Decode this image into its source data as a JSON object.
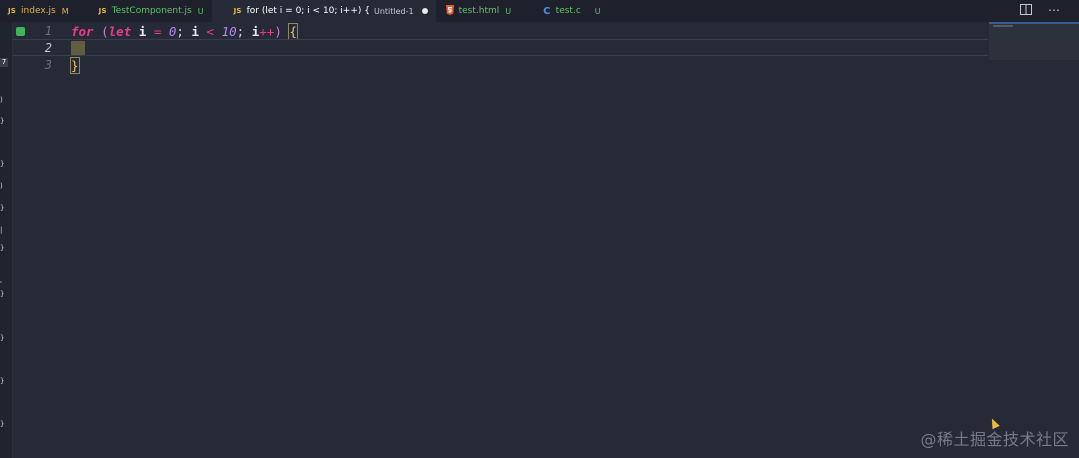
{
  "tabs": [
    {
      "icon": "JS",
      "icon_color": "#e8c13a",
      "label": "index.js",
      "status": "M",
      "status_color": "#e2b14a",
      "label_color": "#e2b14a",
      "active": false
    },
    {
      "icon": "JS",
      "icon_color": "#e8c13a",
      "label": "TestComponent.js",
      "status": "U",
      "status_color": "#5fc36b",
      "label_color": "#5fc36b",
      "active": false
    },
    {
      "icon": "JS",
      "icon_color": "#e8c13a",
      "label": "for (let i = 0; i < 10; i++) {",
      "sub": "Untitled-1",
      "dirty": true,
      "label_color": "#ffffff",
      "active": true
    },
    {
      "icon": "html5-icon",
      "icon_color": "#e65c2f",
      "label": "test.html",
      "status": "U",
      "status_color": "#5fc36b",
      "label_color": "#5fc36b",
      "active": false
    },
    {
      "icon": "C",
      "icon_color": "#4a8fe0",
      "label": "test.c",
      "status": "U",
      "status_color": "#5fc36b",
      "label_color": "#5fc36b",
      "active": false
    }
  ],
  "editor": {
    "line_numbers": [
      "1",
      "2",
      "3"
    ],
    "current_line": 2,
    "lines": [
      "for (let i = 0; i < 10; i++) {",
      "",
      "}"
    ]
  },
  "activity_strip": {
    "glyphs": [
      "7",
      ")",
      "}",
      "}",
      ")",
      "}",
      "|",
      "}",
      "'",
      "}",
      "}",
      "}",
      "}"
    ]
  },
  "watermark": "@稀土掘金技术社区",
  "colors": {
    "background": "#262a36",
    "tabbar": "#1e212b",
    "keyword": "#e93a8f",
    "number": "#b58bf0",
    "brace": "#f3c65a",
    "breakpoint": "#3db45d"
  }
}
